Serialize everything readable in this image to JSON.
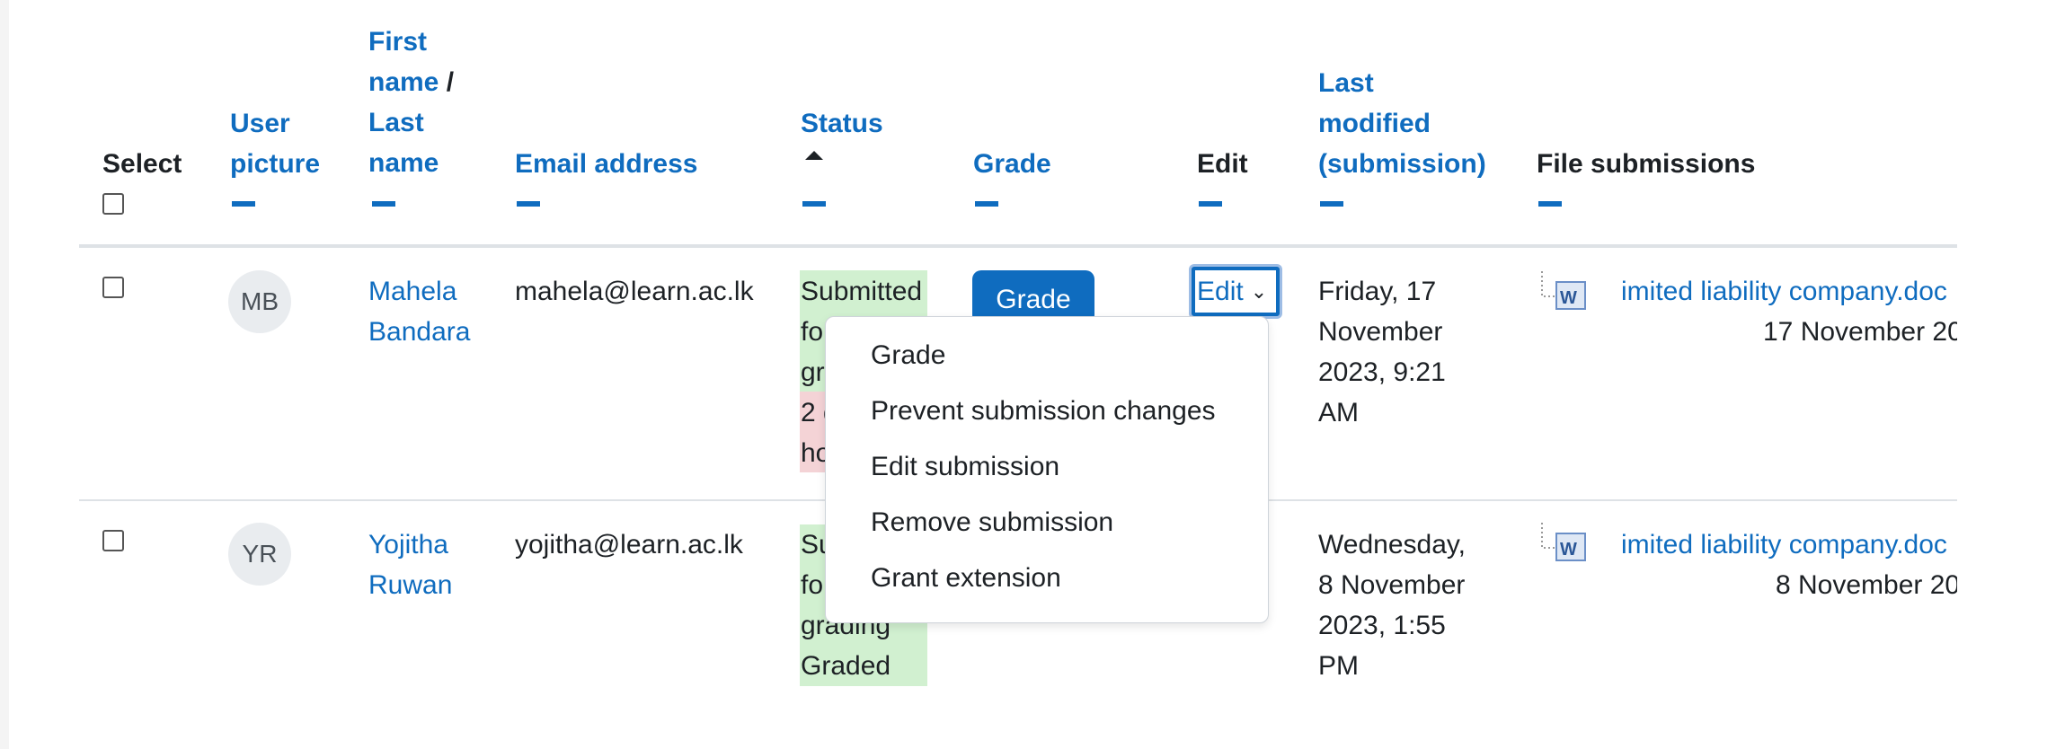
{
  "header": {
    "select": "Select",
    "user_picture": [
      "User",
      "picture"
    ],
    "first_name": "First",
    "name1": "name",
    "slash": "/",
    "last": "Last",
    "name2": "name",
    "email": "Email address",
    "status": "Status",
    "grade": "Grade",
    "edit": "Edit",
    "last_modified": [
      "Last",
      "modified",
      "(submission)"
    ],
    "file_submissions": "File submissions"
  },
  "rows": [
    {
      "initials": "MB",
      "first": "Mahela",
      "last": "Bandara",
      "email": "mahela@learn.ac.lk",
      "status_lines": [
        "Submitted",
        "for",
        "gra",
        "2 d",
        "ho"
      ],
      "grade_button": "Grade",
      "edit_select": "Edit",
      "modified": [
        "Friday, 17",
        "November",
        "2023, 9:21",
        "AM"
      ],
      "file_name": "imited liability company.doc",
      "file_date": "17 November 20"
    },
    {
      "initials": "YR",
      "first": "Yojitha",
      "last": "Ruwan",
      "email": "yojitha@learn.ac.lk",
      "status_lines": [
        "Su",
        "fo",
        "grading",
        "Graded"
      ],
      "modified": [
        "Wednesday,",
        "8 November",
        "2023, 1:55",
        "PM"
      ],
      "file_name": "imited liability company.doc",
      "file_date": "8 November 20"
    }
  ],
  "dropdown": {
    "items": [
      "Grade",
      "Prevent submission changes",
      "Edit submission",
      "Remove submission",
      "Grant extension"
    ]
  },
  "colors": {
    "link": "#0f6cbf",
    "submitted_bg": "#d1f0d0",
    "overdue_bg": "#f4d3d6"
  }
}
